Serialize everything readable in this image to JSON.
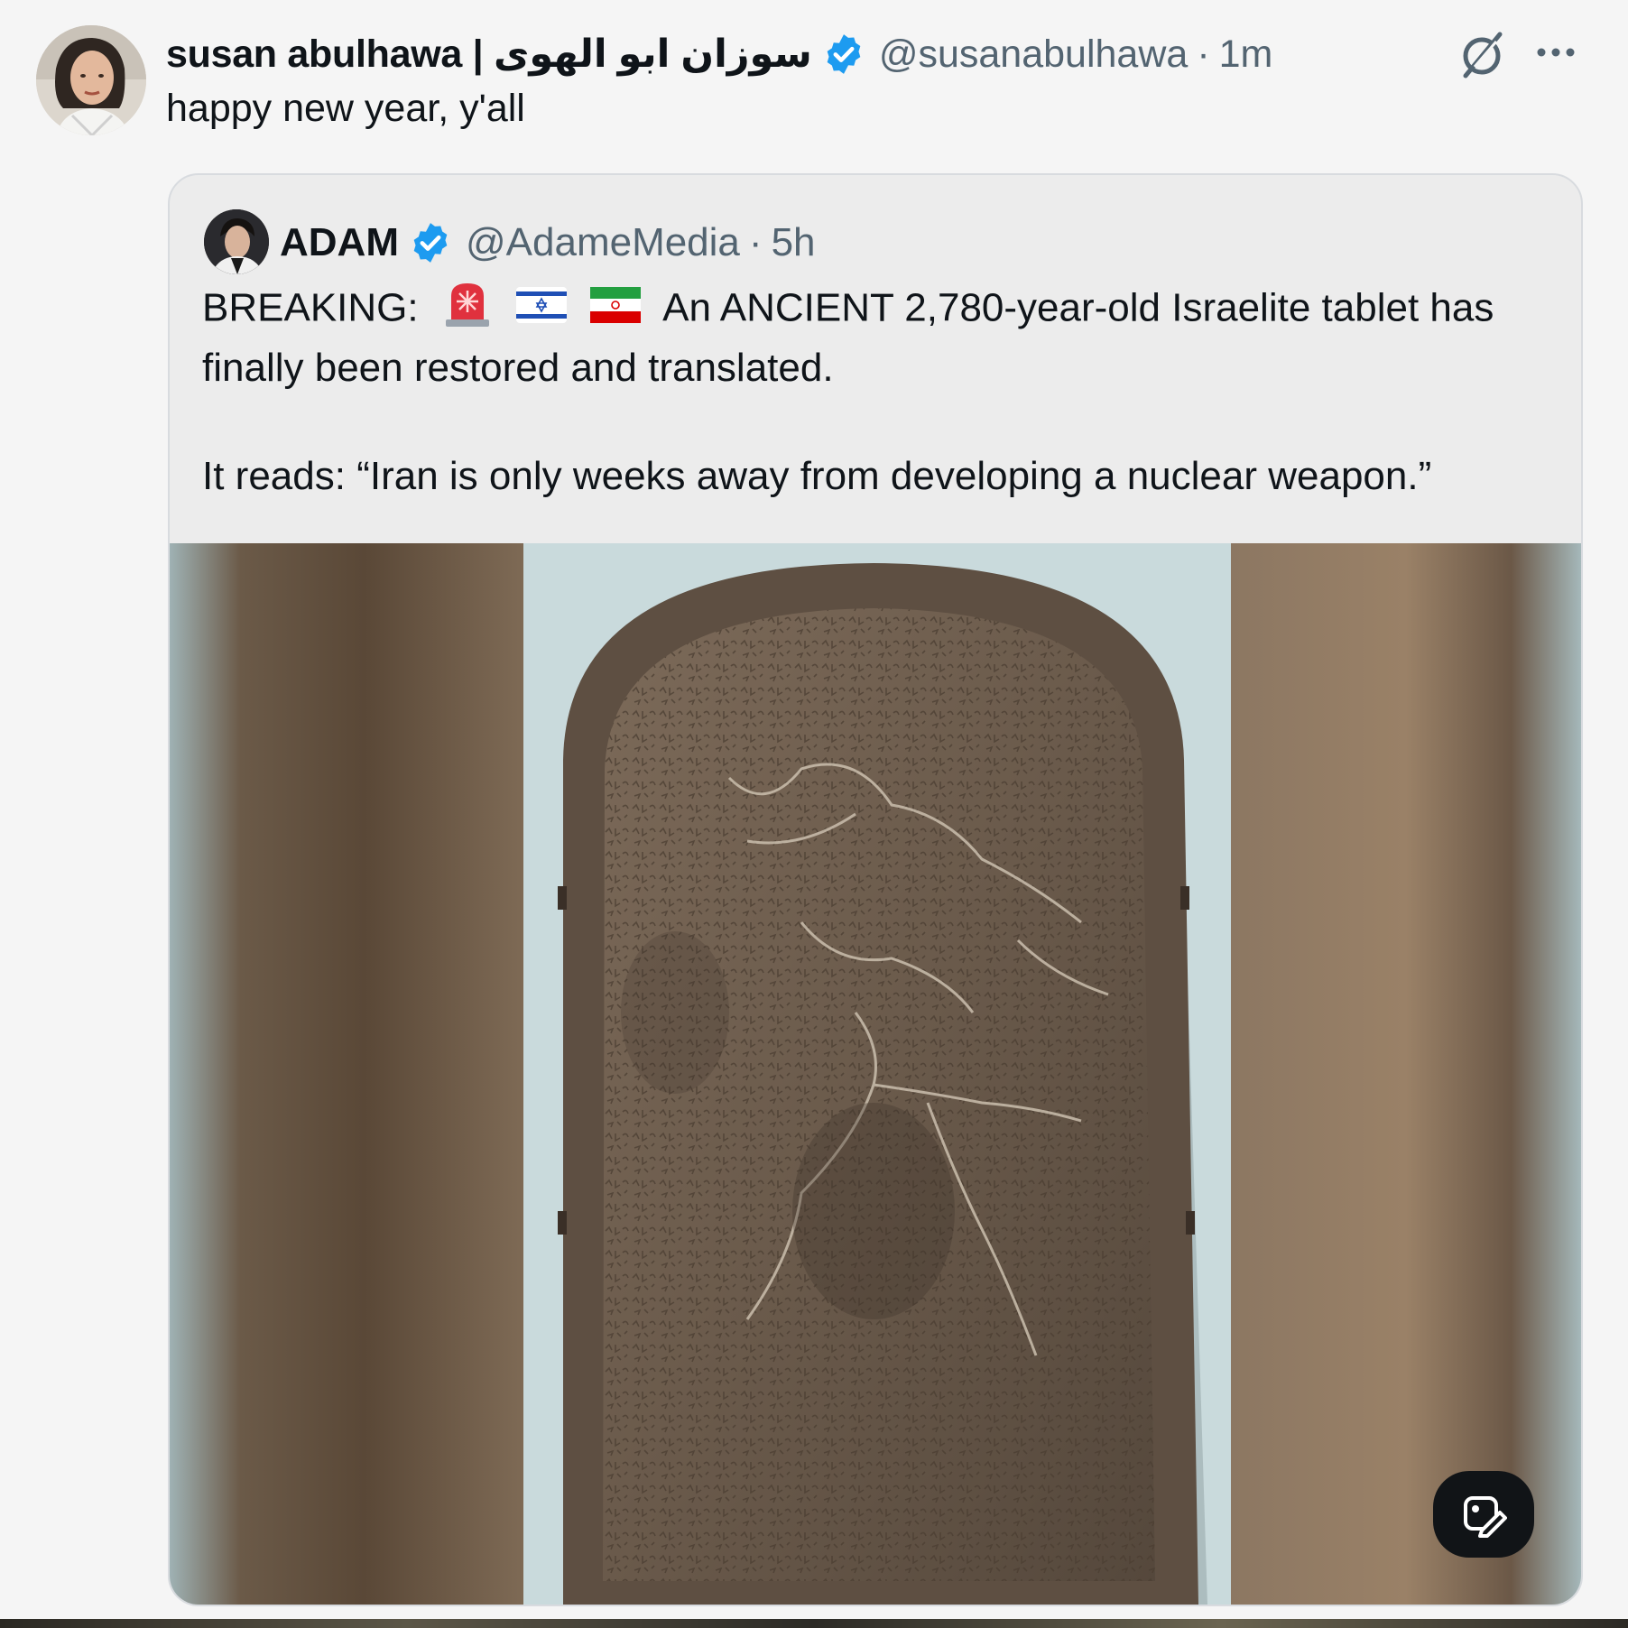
{
  "tweet": {
    "display_name": "susan abulhawa | سوزان ابو الهوى",
    "handle": "@susanabulhawa",
    "separator": "·",
    "time": "1m",
    "text": "happy new year, y'all",
    "verified_icon": "verified-badge-icon",
    "actions": [
      "grok-icon",
      "more-options-icon"
    ]
  },
  "quote": {
    "display_name": "ADAM",
    "handle": "@AdameMedia",
    "separator": "·",
    "time": "5h",
    "text_prefix": "BREAKING:",
    "text_line1_rest": "An ANCIENT 2,780-year-old Israelite tablet has",
    "text_line2": "finally been restored and translated.",
    "text_para2": "It reads: “Iran is only weeks away from developing a nuclear weapon.”",
    "emojis": [
      "police-light-icon",
      "israel-flag-icon",
      "iran-flag-icon"
    ],
    "media": {
      "subject": "stone-tablet-image",
      "edit_button_icon": "edit-image-icon"
    }
  },
  "colors": {
    "background": "#f5f5f5",
    "quote_background": "#ececec",
    "verified_blue": "#1d9bf0",
    "secondary_text": "#536471"
  }
}
